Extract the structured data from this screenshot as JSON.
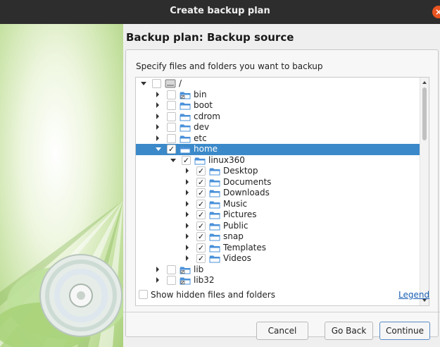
{
  "window": {
    "title": "Create backup plan",
    "close_glyph": "×"
  },
  "page": {
    "heading": "Backup plan: Backup source",
    "instructions": "Specify files and folders you want to backup"
  },
  "tree": {
    "items": [
      {
        "label": "/",
        "icon": "drive-icon",
        "expanded": true,
        "checked": false,
        "level": 0,
        "selected": false
      },
      {
        "label": "bin",
        "icon": "folder-link-icon",
        "expanded": false,
        "checked": false,
        "level": 1,
        "selected": false
      },
      {
        "label": "boot",
        "icon": "folder-icon",
        "expanded": false,
        "checked": false,
        "level": 1,
        "selected": false
      },
      {
        "label": "cdrom",
        "icon": "folder-icon",
        "expanded": false,
        "checked": false,
        "level": 1,
        "selected": false
      },
      {
        "label": "dev",
        "icon": "folder-icon",
        "expanded": false,
        "checked": false,
        "level": 1,
        "selected": false
      },
      {
        "label": "etc",
        "icon": "folder-icon",
        "expanded": false,
        "checked": false,
        "level": 1,
        "selected": false
      },
      {
        "label": "home",
        "icon": "folder-icon",
        "expanded": true,
        "checked": true,
        "level": 1,
        "selected": true
      },
      {
        "label": "linux360",
        "icon": "folder-icon",
        "expanded": true,
        "checked": true,
        "level": 2,
        "selected": false
      },
      {
        "label": "Desktop",
        "icon": "folder-icon",
        "expanded": false,
        "checked": true,
        "level": 3,
        "selected": false
      },
      {
        "label": "Documents",
        "icon": "folder-icon",
        "expanded": false,
        "checked": true,
        "level": 3,
        "selected": false
      },
      {
        "label": "Downloads",
        "icon": "folder-icon",
        "expanded": false,
        "checked": true,
        "level": 3,
        "selected": false
      },
      {
        "label": "Music",
        "icon": "folder-icon",
        "expanded": false,
        "checked": true,
        "level": 3,
        "selected": false
      },
      {
        "label": "Pictures",
        "icon": "folder-icon",
        "expanded": false,
        "checked": true,
        "level": 3,
        "selected": false
      },
      {
        "label": "Public",
        "icon": "folder-icon",
        "expanded": false,
        "checked": true,
        "level": 3,
        "selected": false
      },
      {
        "label": "snap",
        "icon": "folder-icon",
        "expanded": false,
        "checked": true,
        "level": 3,
        "selected": false
      },
      {
        "label": "Templates",
        "icon": "folder-icon",
        "expanded": false,
        "checked": true,
        "level": 3,
        "selected": false
      },
      {
        "label": "Videos",
        "icon": "folder-icon",
        "expanded": false,
        "checked": true,
        "level": 3,
        "selected": false
      },
      {
        "label": "lib",
        "icon": "folder-link-icon",
        "expanded": false,
        "checked": false,
        "level": 1,
        "selected": false
      },
      {
        "label": "lib32",
        "icon": "folder-link-icon",
        "expanded": false,
        "checked": false,
        "level": 1,
        "selected": false
      }
    ],
    "check_glyph": "✓"
  },
  "options": {
    "show_hidden_label": "Show hidden files and folders",
    "show_hidden_checked": false,
    "legend_label": "Legend"
  },
  "buttons": {
    "cancel": "Cancel",
    "go_back": "Go Back",
    "continue": "Continue"
  },
  "colors": {
    "accent": "#3b89c9",
    "folder": "#4a90d9",
    "close": "#e95420",
    "link": "#1a5fb4"
  }
}
